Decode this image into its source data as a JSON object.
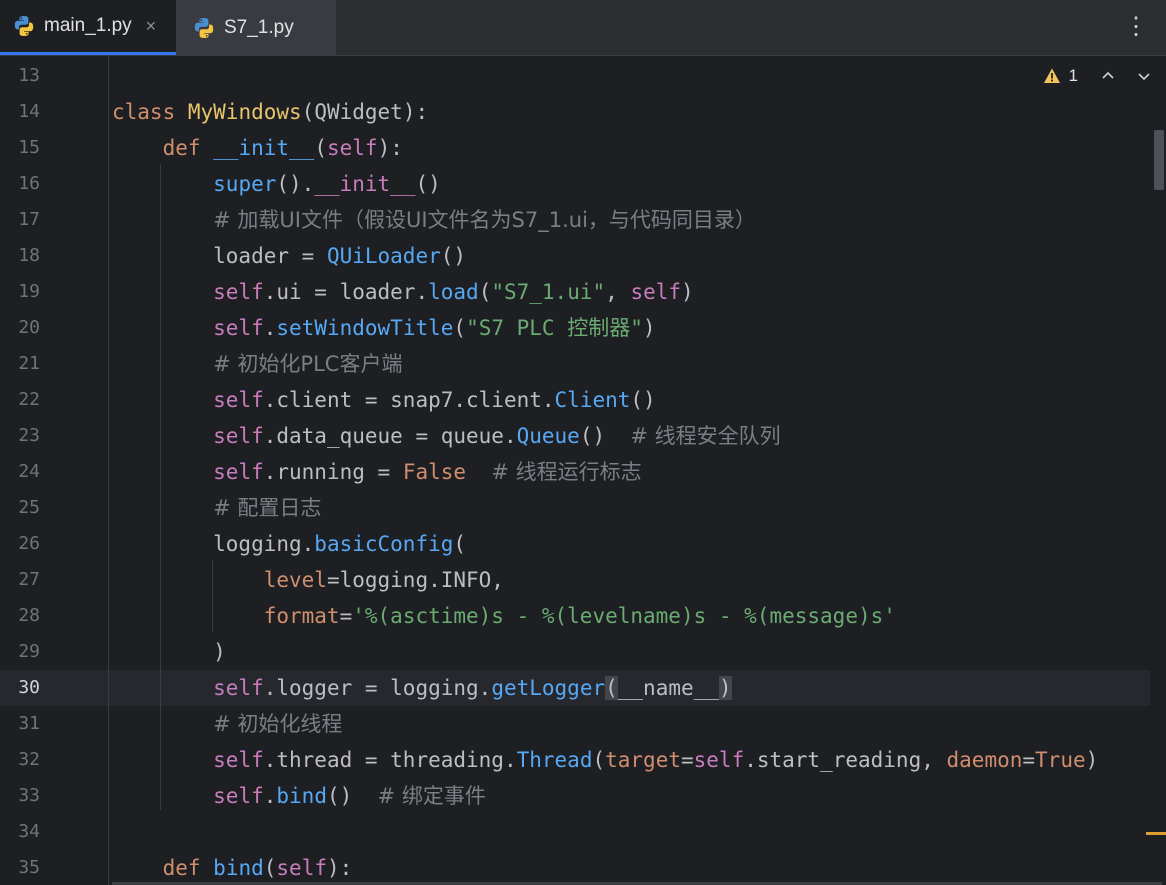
{
  "tabs": [
    {
      "label": "main_1.py",
      "active": true,
      "close": "×"
    },
    {
      "label": "S7_1.py",
      "active": false
    }
  ],
  "more_label": "⋮",
  "inspections": {
    "count": "1"
  },
  "current_line": 30,
  "lines": [
    {
      "n": "13",
      "t": ""
    },
    {
      "n": "14",
      "t": "class MyWindows(QWidget):"
    },
    {
      "n": "15",
      "t": "    def __init__(self):"
    },
    {
      "n": "16",
      "t": "        super().__init__()"
    },
    {
      "n": "17",
      "t": "        # 加载UI文件（假设UI文件名为S7_1.ui，与代码同目录）"
    },
    {
      "n": "18",
      "t": "        loader = QUiLoader()"
    },
    {
      "n": "19",
      "t": "        self.ui = loader.load(\"S7_1.ui\", self)"
    },
    {
      "n": "20",
      "t": "        self.setWindowTitle(\"S7 PLC 控制器\")"
    },
    {
      "n": "21",
      "t": "        # 初始化PLC客户端"
    },
    {
      "n": "22",
      "t": "        self.client = snap7.client.Client()"
    },
    {
      "n": "23",
      "t": "        self.data_queue = queue.Queue()  # 线程安全队列"
    },
    {
      "n": "24",
      "t": "        self.running = False  # 线程运行标志"
    },
    {
      "n": "25",
      "t": "        # 配置日志"
    },
    {
      "n": "26",
      "t": "        logging.basicConfig("
    },
    {
      "n": "27",
      "t": "            level=logging.INFO,"
    },
    {
      "n": "28",
      "t": "            format='%(asctime)s - %(levelname)s - %(message)s'"
    },
    {
      "n": "29",
      "t": "        )"
    },
    {
      "n": "30",
      "t": "        self.logger = logging.getLogger(__name__)"
    },
    {
      "n": "31",
      "t": "        # 初始化线程"
    },
    {
      "n": "32",
      "t": "        self.thread = threading.Thread(target=self.start_reading, daemon=True)"
    },
    {
      "n": "33",
      "t": "        self.bind()  # 绑定事件"
    },
    {
      "n": "34",
      "t": ""
    },
    {
      "n": "35",
      "t": "    def bind(self):"
    }
  ]
}
